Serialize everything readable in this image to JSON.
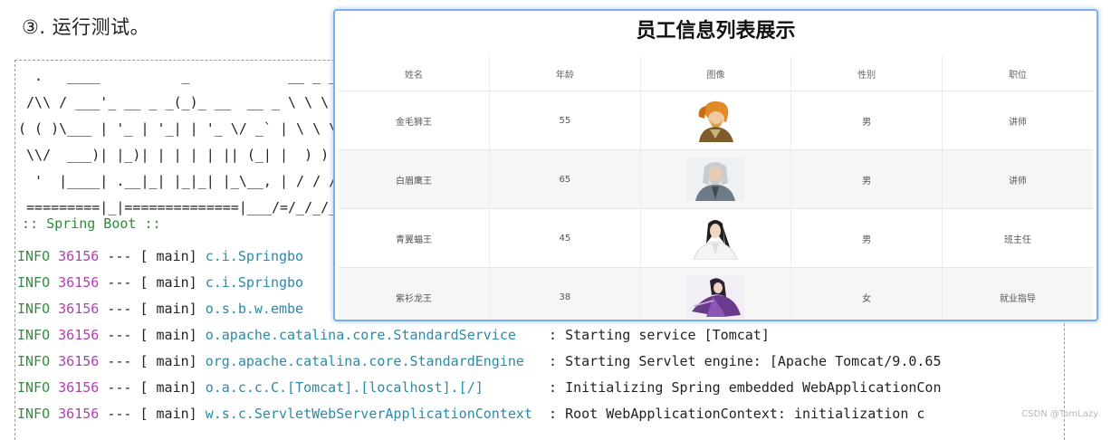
{
  "step_title": "③. 运行测试。",
  "console": {
    "ascii_banner": [
      "  .   ____          _            __ _ _",
      " /\\\\ / ___'_ __ _ _(_)_ __  __ _ \\ \\ \\ \\",
      "( ( )\\___ | '_ | '_| | '_ \\/ _` | \\ \\ \\ \\",
      " \\\\/  ___)| |_)| | | | | || (_| |  ) ) ) )",
      "  '  |____| .__|_| |_|_| |_\\__, | / / / /",
      " =========|_|==============|___/=/_/_/_/"
    ],
    "spring_boot_line": ":: Spring Boot ::",
    "log_lines": [
      {
        "level": "INFO",
        "pid": "36156",
        "sep": "---",
        "thread": "[ main]",
        "logger": "c.i.Springbo",
        "message": ""
      },
      {
        "level": "INFO",
        "pid": "36156",
        "sep": "---",
        "thread": "[ main]",
        "logger": "c.i.Springbo",
        "message": ""
      },
      {
        "level": "INFO",
        "pid": "36156",
        "sep": "---",
        "thread": "[ main]",
        "logger": "o.s.b.w.embe",
        "message": ""
      },
      {
        "level": "INFO",
        "pid": "36156",
        "sep": "---",
        "thread": "[ main]",
        "logger": "o.apache.catalina.core.StandardService   ",
        "message": ": Starting service [Tomcat]"
      },
      {
        "level": "INFO",
        "pid": "36156",
        "sep": "---",
        "thread": "[ main]",
        "logger": "org.apache.catalina.core.StandardEngine  ",
        "message": ": Starting Servlet engine: [Apache Tomcat/9.0.65"
      },
      {
        "level": "INFO",
        "pid": "36156",
        "sep": "---",
        "thread": "[ main]",
        "logger": "o.a.c.c.C.[Tomcat].[localhost].[/]       ",
        "message": ": Initializing Spring embedded WebApplicationCon"
      },
      {
        "level": "INFO",
        "pid": "36156",
        "sep": "---",
        "thread": "[ main]",
        "logger": "w.s.c.ServletWebServerApplicationContext ",
        "message": ": Root WebApplicationContext: initialization c"
      }
    ]
  },
  "result": {
    "title": "员工信息列表展示",
    "columns": [
      "姓名",
      "年龄",
      "图像",
      "性别",
      "职位"
    ],
    "rows": [
      {
        "name": "金毛狮王",
        "age": "55",
        "avatar": "golden-lion-portrait",
        "gender": "男",
        "job": "讲师"
      },
      {
        "name": "白眉鹰王",
        "age": "65",
        "avatar": "white-eyebrow-eagle-portrait",
        "gender": "男",
        "job": "讲师"
      },
      {
        "name": "青翼蝠王",
        "age": "45",
        "avatar": "green-wing-bat-portrait",
        "gender": "男",
        "job": "班主任"
      },
      {
        "name": "紫衫龙王",
        "age": "38",
        "avatar": "purple-dragon-portrait",
        "gender": "女",
        "job": "就业指导"
      }
    ]
  },
  "watermark": "CSDN @TomLazy"
}
